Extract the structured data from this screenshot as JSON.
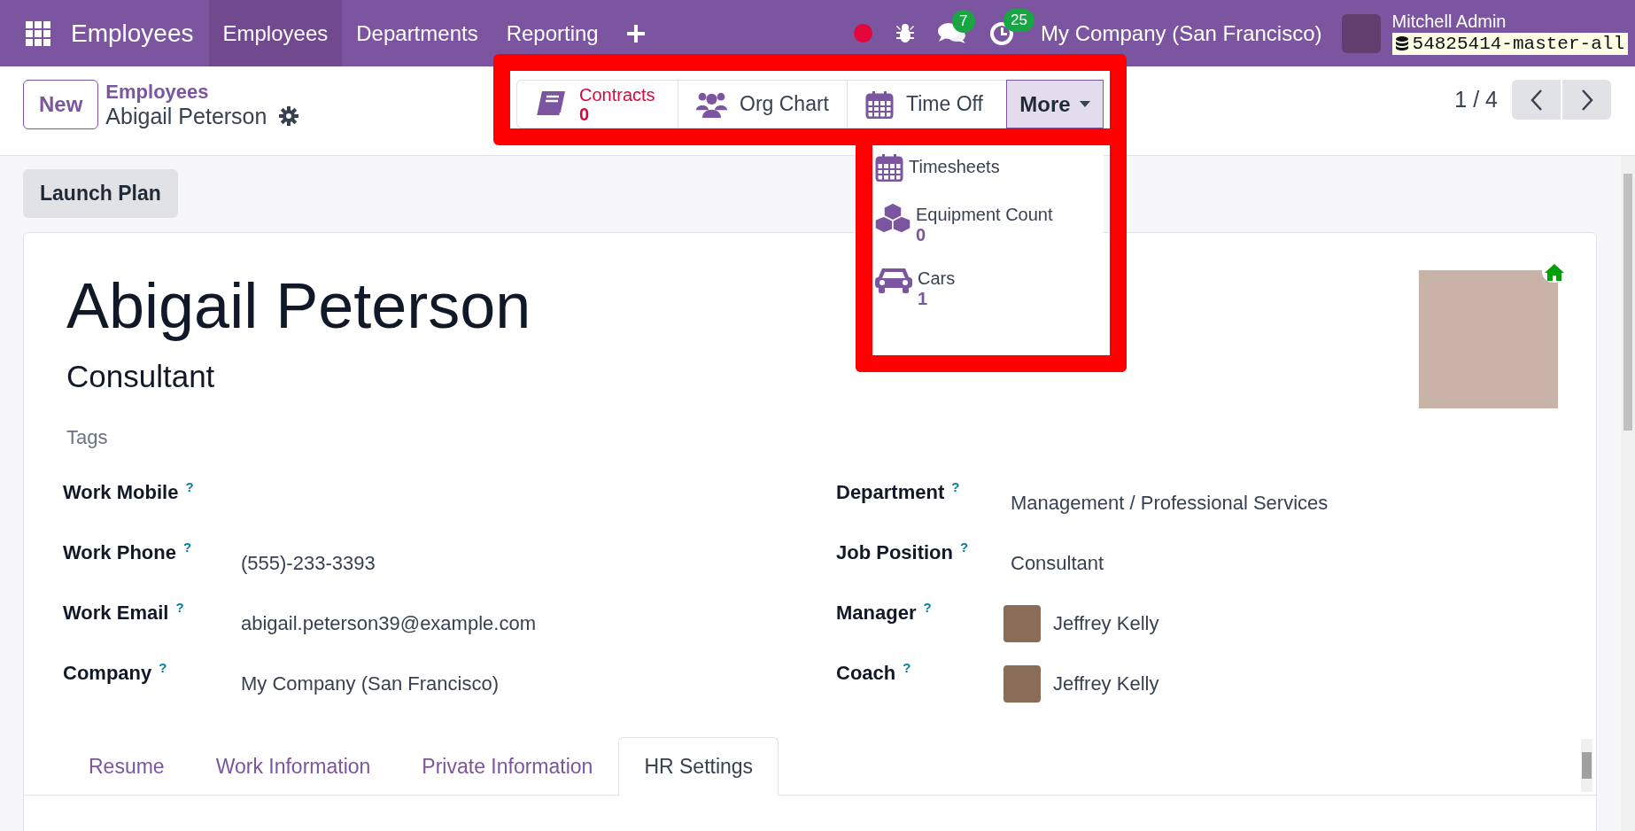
{
  "navbar": {
    "app_name": "Employees",
    "menu": [
      {
        "label": "Employees",
        "selected": true
      },
      {
        "label": "Departments",
        "selected": false
      },
      {
        "label": "Reporting",
        "selected": false
      }
    ],
    "messages_badge": "7",
    "activities_badge": "25",
    "company": "My Company (San Francisco)",
    "user": "Mitchell Admin",
    "database": "54825414-master-all"
  },
  "control_panel": {
    "new_button": "New",
    "breadcrumb": "Employees",
    "record": "Abigail Peterson",
    "pager": "1 / 4"
  },
  "smart_buttons": [
    {
      "label": "Contracts",
      "value": "0",
      "alert": true
    },
    {
      "label": "Org Chart",
      "alert": false
    },
    {
      "label": "Time Off",
      "alert": false
    }
  ],
  "more_menu": {
    "label": "More",
    "expanded": true,
    "items": [
      {
        "label": "Timesheets"
      },
      {
        "label": "Equipment Count",
        "value": "0"
      },
      {
        "label": "Cars",
        "value": "1"
      }
    ]
  },
  "header_buttons": [
    "Launch Plan"
  ],
  "employee": {
    "name": "Abigail Peterson",
    "job_title": "Consultant",
    "tags_placeholder": "Tags"
  },
  "fields_left": [
    {
      "label": "Work Mobile",
      "help": "?",
      "kind": "text"
    },
    {
      "label": "Work Phone",
      "help": "?",
      "kind": "text",
      "value": "(555)-233-3393"
    },
    {
      "label": "Work Email",
      "help": "?",
      "kind": "text",
      "value": "abigail.peterson39@example.com"
    },
    {
      "label": "Company",
      "help": "?",
      "kind": "text",
      "value": "My Company (San Francisco)"
    }
  ],
  "fields_right": [
    {
      "label": "Department",
      "help": "?",
      "kind": "text",
      "value": "Management / Professional Services"
    },
    {
      "label": "Job Position",
      "help": "?",
      "kind": "text",
      "value": "Consultant"
    },
    {
      "label": "Manager",
      "help": "?",
      "kind": "avatar",
      "value": "Jeffrey Kelly"
    },
    {
      "label": "Coach",
      "help": "?",
      "kind": "avatar",
      "value": "Jeffrey Kelly"
    }
  ],
  "tabs": [
    {
      "label": "Resume",
      "selected": false
    },
    {
      "label": "Work Information",
      "selected": false
    },
    {
      "label": "Private Information",
      "selected": false
    },
    {
      "label": "HR Settings",
      "selected": true
    }
  ]
}
